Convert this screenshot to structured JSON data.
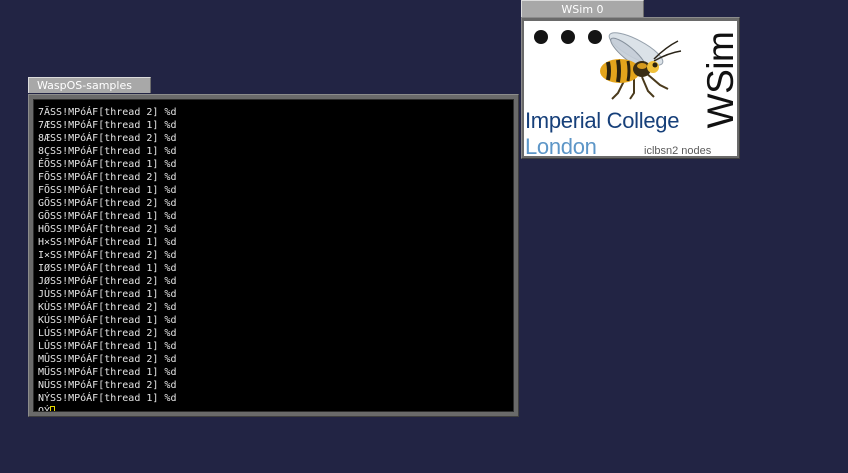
{
  "terminal_window": {
    "title": "WaspOS-samples",
    "lines": [
      "7ÄSS!MPóÁF[thread 2] %d",
      "7ÆSS!MPóÁF[thread 1] %d",
      "8ÆSS!MPóÁF[thread 2] %d",
      "8ÇSS!MPóÁF[thread 1] %d",
      "ÉÕSS!MPóÁF[thread 1] %d",
      "FÕSS!MPóÁF[thread 2] %d",
      "FÕSS!MPóÁF[thread 1] %d",
      "GÕSS!MPóÁF[thread 2] %d",
      "GÕSS!MPóÁF[thread 1] %d",
      "HÕSS!MPóÁF[thread 2] %d",
      "H×SS!MPóÁF[thread 1] %d",
      "I×SS!MPóÁF[thread 2] %d",
      "IØSS!MPóÁF[thread 1] %d",
      "JØSS!MPóÁF[thread 2] %d",
      "JÙSS!MPóÁF[thread 1] %d",
      "KÙSS!MPóÁF[thread 2] %d",
      "KÚSS!MPóÁF[thread 1] %d",
      "LÚSS!MPóÁF[thread 2] %d",
      "LÛSS!MPóÁF[thread 1] %d",
      "MÛSS!MPóÁF[thread 2] %d",
      "MÜSS!MPóÁF[thread 1] %d",
      "NÜSS!MPóÁF[thread 2] %d",
      "NÝSS!MPóÁF[thread 1] %d"
    ],
    "prompt_text": "OÝ"
  },
  "wsim_window": {
    "title": "WSim 0",
    "leds": [
      "off",
      "off",
      "off"
    ],
    "logo_line1": "Imperial College",
    "logo_line2": "London",
    "node_label": "iclbsn2 nodes",
    "vertical_label": "WSim"
  },
  "colors": {
    "desktop_background": "#222444",
    "terminal_background": "#000000",
    "terminal_text": "#e4e4e4",
    "cursor": "#e6d900",
    "imperial_blue": "#17407a",
    "london_blue": "#5d96c7"
  },
  "icons": {
    "wasp": "wasp-icon",
    "led": "led-icon"
  }
}
